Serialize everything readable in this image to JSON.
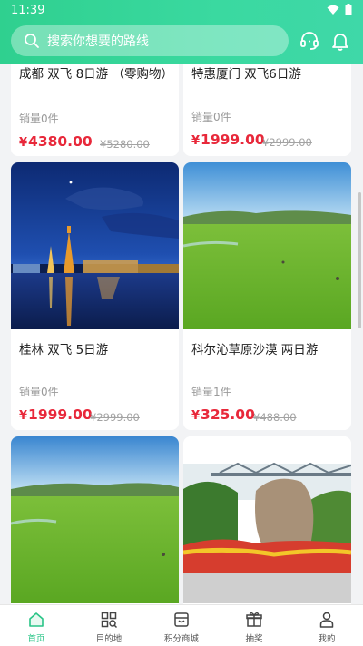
{
  "status_bar": {
    "time": "11:39"
  },
  "search": {
    "placeholder": "搜索你想要的路线"
  },
  "header_icons": [
    "headset-icon",
    "bell-icon"
  ],
  "colors": {
    "accent": "#2fd08f",
    "price": "#e8283a",
    "muted": "#9a9a9a"
  },
  "products": [
    {
      "title": "成都 双飞 8日游 （零购物）",
      "sales": "销量0件",
      "price": "4380.00",
      "original": "¥5280.00",
      "currency": "¥"
    },
    {
      "title": "特惠厦门 双飞6日游",
      "sales": "销量0件",
      "price": "1999.00",
      "original": "¥2999.00",
      "currency": "¥"
    },
    {
      "title": "桂林 双飞 5日游",
      "sales": "销量0件",
      "price": "1999.00",
      "original": "¥2999.00",
      "currency": "¥"
    },
    {
      "title": "科尔沁草原沙漠 两日游",
      "sales": "销量1件",
      "price": "325.00",
      "original": "¥488.00",
      "currency": "¥"
    }
  ],
  "tabbar": [
    {
      "label": "首页",
      "icon": "home-icon",
      "active": true
    },
    {
      "label": "目的地",
      "icon": "grid-search-icon",
      "active": false
    },
    {
      "label": "积分商城",
      "icon": "shop-icon",
      "active": false
    },
    {
      "label": "抽奖",
      "icon": "gift-icon",
      "active": false
    },
    {
      "label": "我的",
      "icon": "user-icon",
      "active": false
    }
  ]
}
